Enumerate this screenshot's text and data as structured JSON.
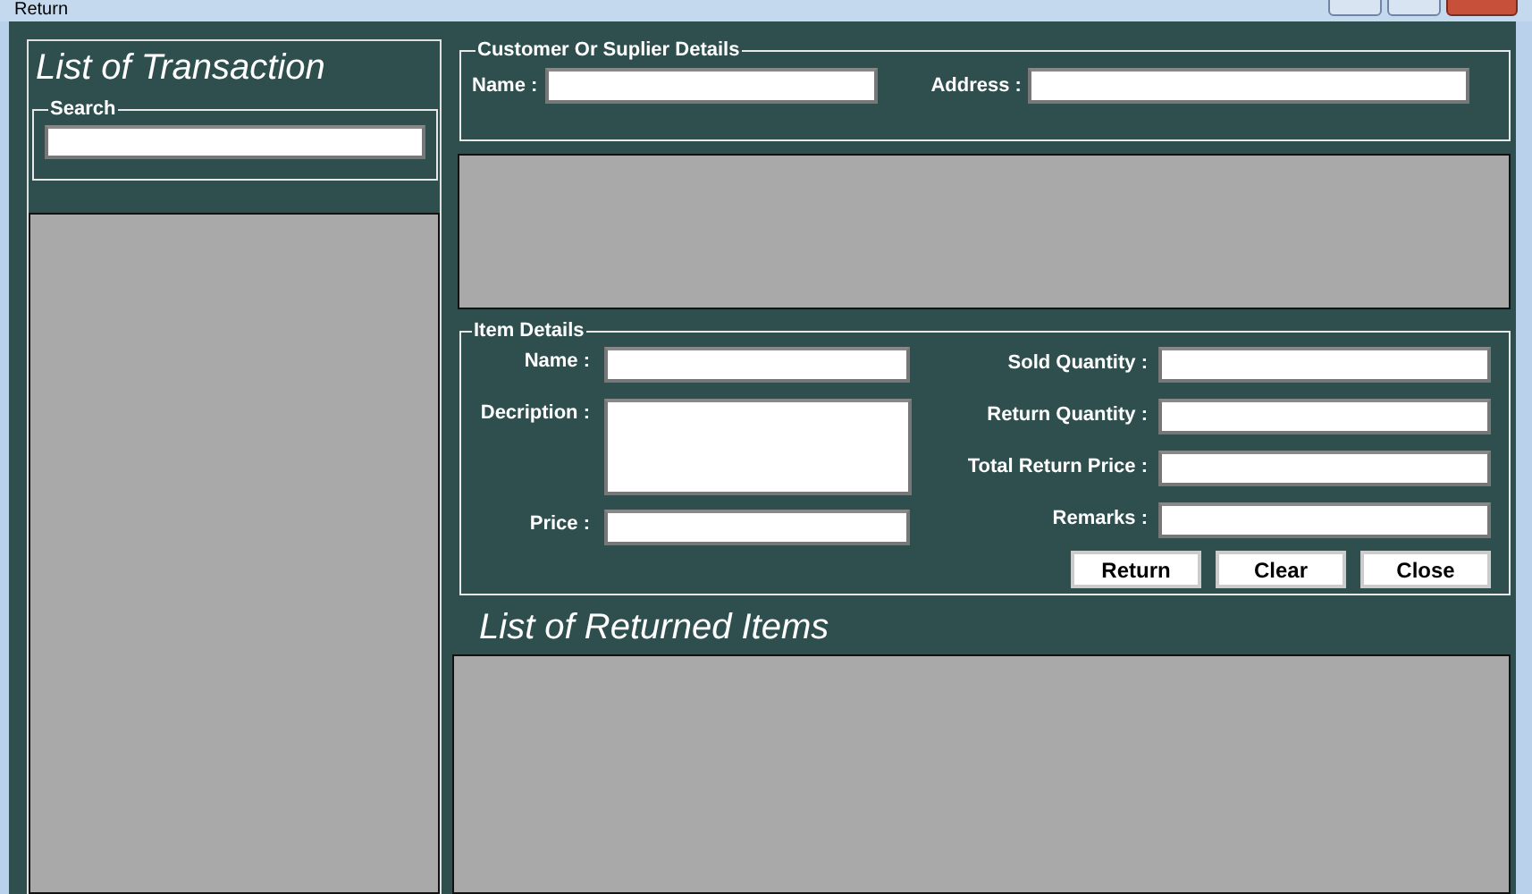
{
  "window": {
    "title": "Return"
  },
  "transactions": {
    "title": "List of Transaction",
    "search": {
      "label": "Search"
    }
  },
  "customer": {
    "legend": "Customer Or Suplier Details",
    "name_label": "Name :",
    "address_label": "Address :"
  },
  "item_details": {
    "legend": "Item Details",
    "left_fields": [
      {
        "label": "Name :",
        "kind": "line"
      },
      {
        "label": "Decription :",
        "kind": "multiline"
      },
      {
        "label": "Price :",
        "kind": "line"
      }
    ],
    "right_fields": [
      {
        "label": "Sold Quantity :"
      },
      {
        "label": "Return Quantity :"
      },
      {
        "label": "Total Return Price :"
      },
      {
        "label": "Remarks :"
      }
    ],
    "buttons": [
      "Return",
      "Clear",
      "Close"
    ]
  },
  "returned": {
    "title": "List of Returned Items"
  }
}
